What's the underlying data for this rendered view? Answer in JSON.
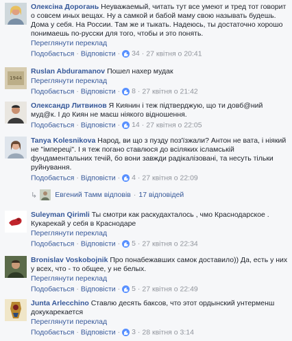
{
  "comments": [
    {
      "author": "Олексіна Дорогань",
      "text": "Неуважаемый, читать тут все умеют и тред тот говорит о совсем иных вещах. Ну а самкой и бабой маму свою называть будешь. Дома у себя. На России. Там же и тыкать. Надеюсь, ты достаточно хорошо понимаешь по-русски для того, чтобы и это понять.",
      "translate": "Переглянути переклад",
      "like": "Подобається",
      "reply": "Відповісти",
      "likes": "34",
      "time": "27 квітня о 20:41"
    },
    {
      "author": "Ruslan Abduramanov",
      "text": "Пошел нахер мудак",
      "translate": "Переглянути переклад",
      "like": "Подобається",
      "reply": "Відповісти",
      "likes": "8",
      "time": "27 квітня о 21:42"
    },
    {
      "author": "Олександр Литвинов",
      "text": "Я Киянин і теж підтверджую, що ти довб@ний муд@к. І до Киян не маєш ніякого відношення.",
      "translate": "",
      "like": "Подобається",
      "reply": "Відповісти",
      "likes": "14",
      "time": "27 квітня о 22:05"
    },
    {
      "author": "Tanya Kolesnikova",
      "text": "Народ, ви що з пузду поз'їзжали? Антон не вата, і ніякий не \"імпереці\". І я теж погано ставлюся до всіляких ісламській фундаментальних течій, бо вони завжди радікалізовані, та несуть тільки руйнування.",
      "translate": "",
      "like": "Подобається",
      "reply": "Відповісти",
      "likes": "4",
      "time": "27 квітня о 22:09"
    },
    {
      "author": "Suleyman Qirimli",
      "text": "Ты смотри как раскудахталось , чмо Краснодарское . Кукарекай у себя в Краснодаре",
      "translate": "Переглянути переклад",
      "like": "Подобається",
      "reply": "Відповісти",
      "likes": "5",
      "time": "27 квітня о 22:34"
    },
    {
      "author": "Bronislav Voskobojnik",
      "text": "Про понабежавших самок доставило)) Да, есть у них у всех, что - то общее, у не белых.",
      "translate": "Переглянути переклад",
      "like": "Подобається",
      "reply": "Відповісти",
      "likes": "5",
      "time": "27 квітня о 22:49"
    },
    {
      "author": "Junta Arlecchino",
      "text": "Ставлю десять баксов, что этот ордынский унтерменш докукарекается",
      "translate": "Переглянути переклад",
      "like": "Подобається",
      "reply": "Відповісти",
      "likes": "3",
      "time": "28 квітня о 3:14"
    }
  ],
  "replies": {
    "name": "Евгений Тамм відповів",
    "separator": "·",
    "count": "17 відповідей"
  },
  "colors": {
    "link": "#365899",
    "meta": "#90949c",
    "like_badge": "#5890ff",
    "background": "#f6f7f9"
  },
  "icons": [
    "like-icon",
    "reply-arrow-icon"
  ]
}
